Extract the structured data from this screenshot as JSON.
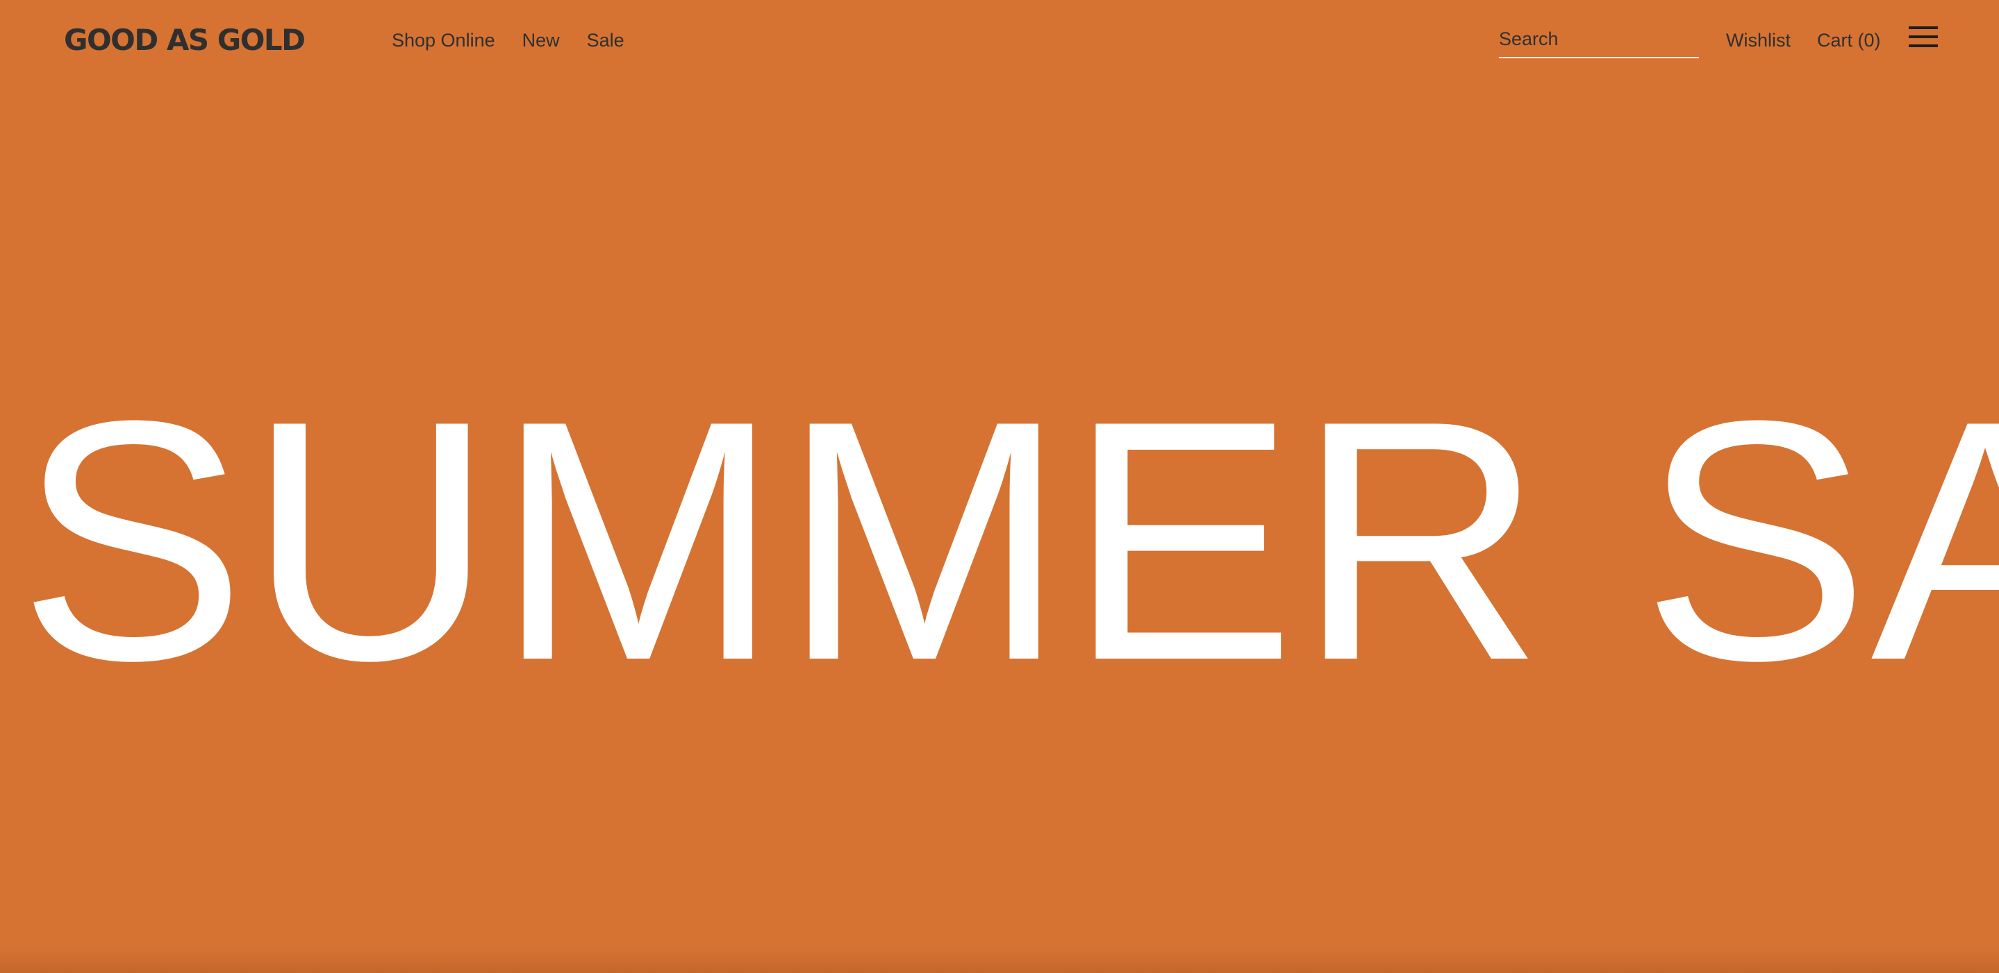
{
  "brand": {
    "logo_text": "GOOD AS GOLD",
    "background_color": "#D67332",
    "text_color": "#2f2f2f"
  },
  "nav": {
    "items": [
      {
        "label": "Shop Online"
      },
      {
        "label": "New"
      },
      {
        "label": "Sale"
      }
    ]
  },
  "search": {
    "placeholder": "Search",
    "value": ""
  },
  "utility": {
    "wishlist_label": "Wishlist",
    "cart_label": "Cart (0)",
    "menu_icon": "hamburger-menu-icon"
  },
  "hero": {
    "headline": "SUMMER SALE",
    "headline_color": "#ffffff"
  }
}
